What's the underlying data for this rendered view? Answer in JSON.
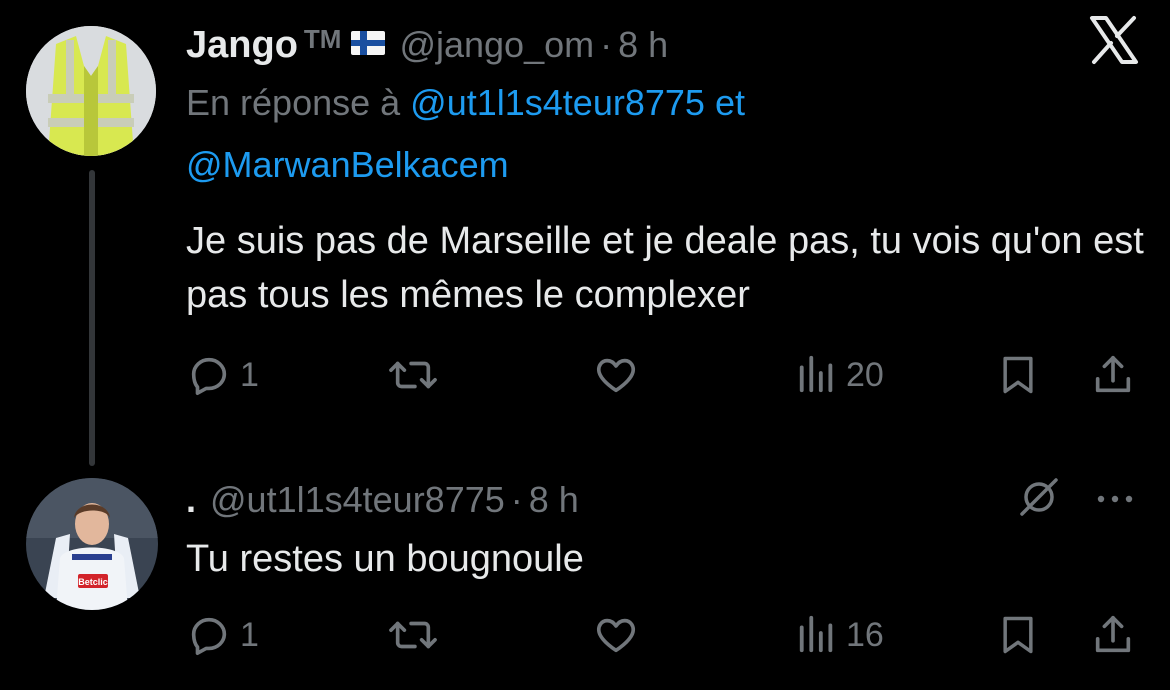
{
  "tweet1": {
    "display_name": "Jango",
    "tm": "TM",
    "flag_icon": "finland-flag-icon",
    "handle": "@jango_om",
    "separator": "·",
    "time": "8 h",
    "reply_prefix": "En réponse à",
    "reply_mention_1": "@ut1l1s4teur8775",
    "reply_and": "et",
    "reply_mention_2": "@MarwanBelkacem",
    "text": "Je suis pas de Marseille et je deale pas, tu vois qu'on est pas tous les mêmes le complexer",
    "replies": "1",
    "retweets": "",
    "likes": "",
    "views": "20"
  },
  "tweet2": {
    "display_name": ".",
    "handle": "@ut1l1s4teur8775",
    "separator": "·",
    "time": "8 h",
    "text": "Tu restes un bougnoule",
    "replies": "1",
    "retweets": "",
    "likes": "",
    "views": "16",
    "avatar_sponsor": "Betclic"
  },
  "icons": {
    "close": "x-logo-icon",
    "reply": "reply-icon",
    "retweet": "retweet-icon",
    "like": "heart-icon",
    "views": "views-icon",
    "bookmark": "bookmark-icon",
    "share": "share-icon",
    "mute": "mute-icon",
    "more": "more-icon"
  },
  "colors": {
    "background": "#000000",
    "text": "#e7e9ea",
    "muted": "#71767b",
    "link": "#1d9bf0"
  }
}
